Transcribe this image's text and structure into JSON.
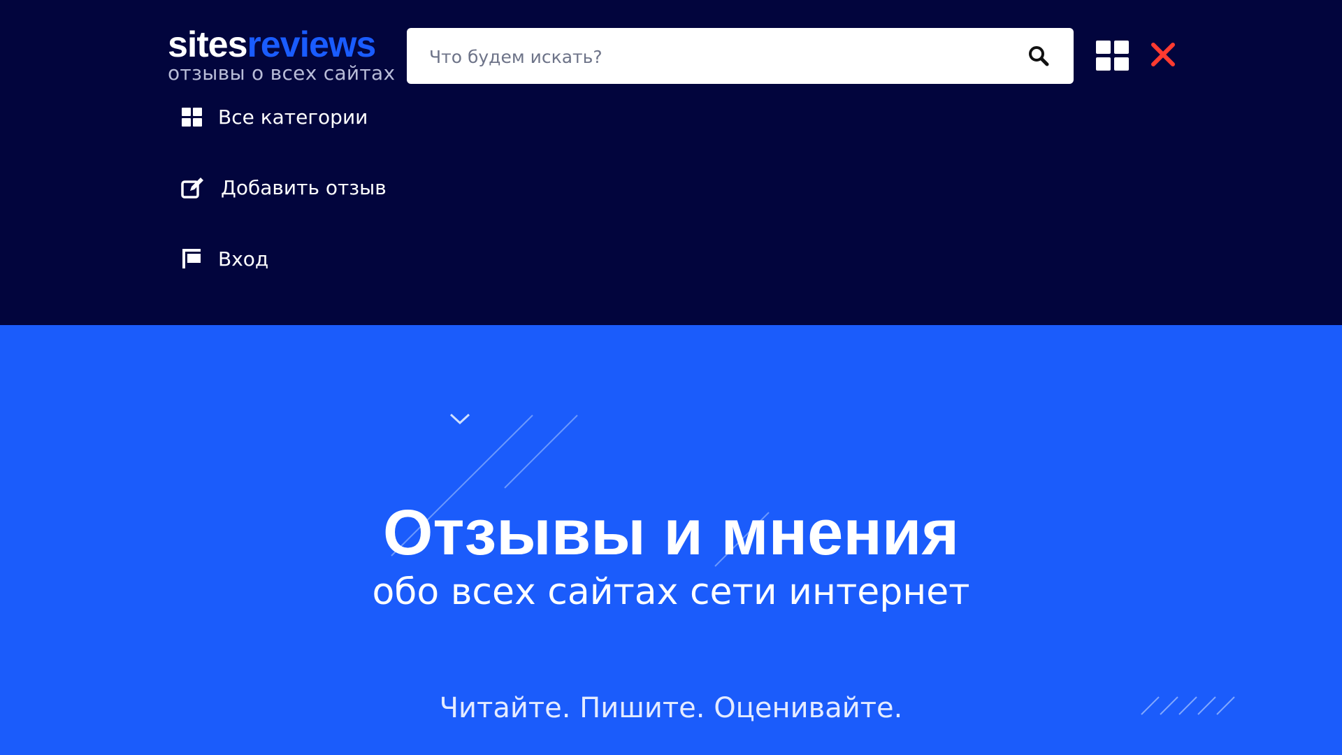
{
  "logo": {
    "part1": "sites",
    "part2": "reviews",
    "tagline": "отзывы о всех сайтах"
  },
  "search": {
    "placeholder": "Что будем искать?",
    "value": ""
  },
  "header_icons": [
    "search-icon",
    "grid-icon",
    "close-icon"
  ],
  "menu": {
    "items": [
      {
        "label": "Все категории",
        "icon": "grid-icon"
      },
      {
        "label": "Добавить отзыв",
        "icon": "edit-icon"
      },
      {
        "label": "Вход",
        "icon": "flag-icon"
      }
    ]
  },
  "hero": {
    "title": "Отзывы и мнения",
    "subtitle": "обо всех сайтах сети интернет",
    "tagline": "Читайте. Пишите. Оценивайте."
  },
  "colors": {
    "header_bg": "#02053d",
    "hero_bg": "#1b5cfb",
    "accent": "#1a5cff",
    "close": "#ff3b30"
  }
}
